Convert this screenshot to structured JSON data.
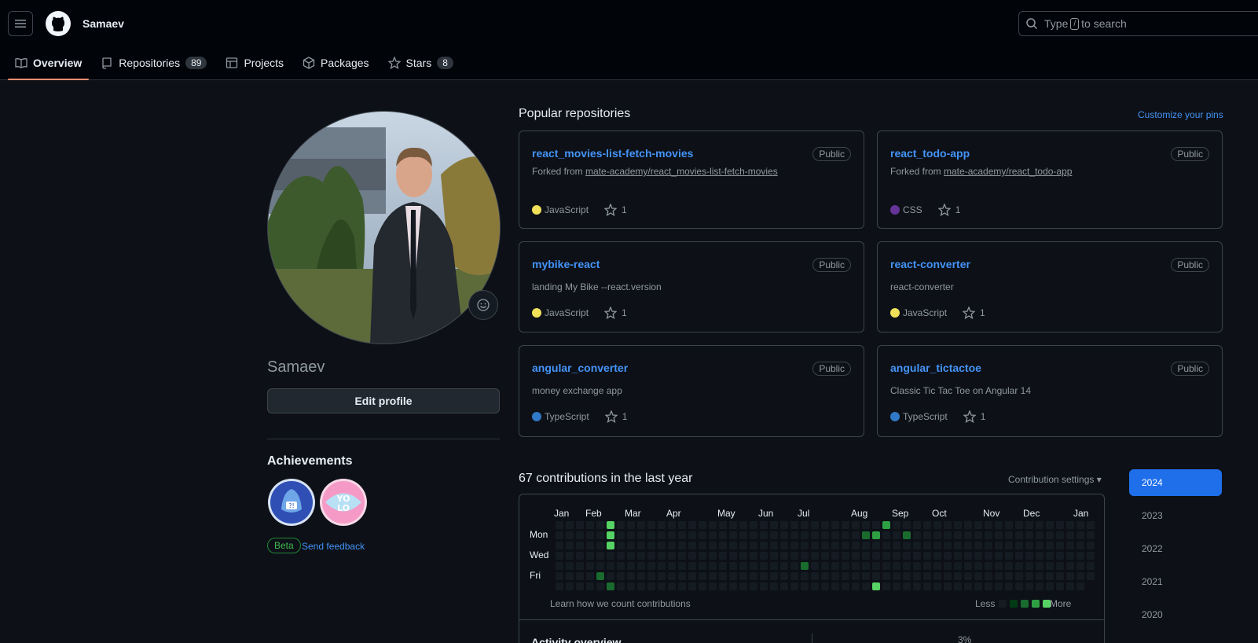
{
  "header": {
    "username": "Samaev",
    "search_prefix": "Type",
    "search_key": "/",
    "search_suffix": "to search"
  },
  "tabs": [
    {
      "label": "Overview",
      "icon": "book-icon",
      "count": ""
    },
    {
      "label": "Repositories",
      "icon": "repo-icon",
      "count": "89"
    },
    {
      "label": "Projects",
      "icon": "table-icon",
      "count": ""
    },
    {
      "label": "Packages",
      "icon": "package-icon",
      "count": ""
    },
    {
      "label": "Stars",
      "icon": "star-icon",
      "count": "8"
    }
  ],
  "profile": {
    "name": "Samaev",
    "edit_label": "Edit profile",
    "achievements_title": "Achievements",
    "beta_label": "Beta",
    "feedback_label": "Send feedback"
  },
  "popular": {
    "title": "Popular repositories",
    "customize_label": "Customize your pins",
    "repos": [
      {
        "name": "react_movies-list-fetch-movies",
        "visibility": "Public",
        "forked_prefix": "Forked from ",
        "forked_from": "mate-academy/react_movies-list-fetch-movies",
        "desc": "",
        "language": "JavaScript",
        "lang_color": "#f1e05a",
        "stars": "1"
      },
      {
        "name": "react_todo-app",
        "visibility": "Public",
        "forked_prefix": "Forked from ",
        "forked_from": "mate-academy/react_todo-app",
        "desc": "",
        "language": "CSS",
        "lang_color": "#663399",
        "stars": "1"
      },
      {
        "name": "mybike-react",
        "visibility": "Public",
        "forked_prefix": "",
        "forked_from": "",
        "desc": "landing My Bike --react.version",
        "language": "JavaScript",
        "lang_color": "#f1e05a",
        "stars": "1"
      },
      {
        "name": "react-converter",
        "visibility": "Public",
        "forked_prefix": "",
        "forked_from": "",
        "desc": "react-converter",
        "language": "JavaScript",
        "lang_color": "#f1e05a",
        "stars": "1"
      },
      {
        "name": "angular_converter",
        "visibility": "Public",
        "forked_prefix": "",
        "forked_from": "",
        "desc": "money exchange app",
        "language": "TypeScript",
        "lang_color": "#3178c6",
        "stars": "1"
      },
      {
        "name": "angular_tictactoe",
        "visibility": "Public",
        "forked_prefix": "",
        "forked_from": "",
        "desc": "Classic Tic Tac Toe on Angular 14",
        "language": "TypeScript",
        "lang_color": "#3178c6",
        "stars": "1"
      }
    ]
  },
  "contributions": {
    "title": "67 contributions in the last year",
    "settings_label": "Contribution settings",
    "months": [
      "Jan",
      "Feb",
      "Mar",
      "Apr",
      "May",
      "Jun",
      "Jul",
      "Aug",
      "Sep",
      "Oct",
      "Nov",
      "Dec",
      "Jan"
    ],
    "days": [
      "Mon",
      "Wed",
      "Fri"
    ],
    "learn_label": "Learn how we count contributions",
    "less_label": "Less",
    "more_label": "More",
    "activity_title": "Activity overview",
    "activity_pct": "3%",
    "colors": {
      "empty": "#151b23",
      "l1": "#033a16",
      "l2": "#196c2e",
      "l3": "#2ea043",
      "l4": "#56d364"
    }
  },
  "years": [
    "2024",
    "2023",
    "2022",
    "2021",
    "2020"
  ]
}
